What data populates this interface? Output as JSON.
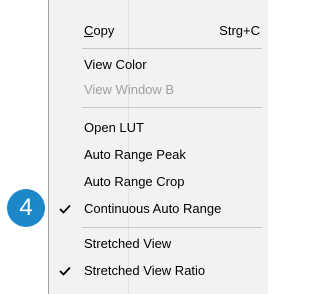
{
  "menu": {
    "items": [
      {
        "label": "Copy",
        "shortcut": "Strg+C",
        "enabled": true,
        "checked": false
      },
      {
        "label": "View Color",
        "enabled": true,
        "checked": false
      },
      {
        "label": "View Window B",
        "enabled": false,
        "checked": false
      },
      {
        "label": "Open LUT",
        "enabled": true,
        "checked": false
      },
      {
        "label": "Auto Range Peak",
        "enabled": true,
        "checked": false
      },
      {
        "label": "Auto Range Crop",
        "enabled": true,
        "checked": false
      },
      {
        "label": "Continuous Auto Range",
        "enabled": true,
        "checked": true
      },
      {
        "label": "Stretched View",
        "enabled": true,
        "checked": false
      },
      {
        "label": "Stretched View Ratio",
        "enabled": true,
        "checked": true
      }
    ]
  },
  "callout": {
    "number": "4",
    "color": "#1c87c9"
  },
  "icons": {
    "check": "checkmark-icon"
  }
}
